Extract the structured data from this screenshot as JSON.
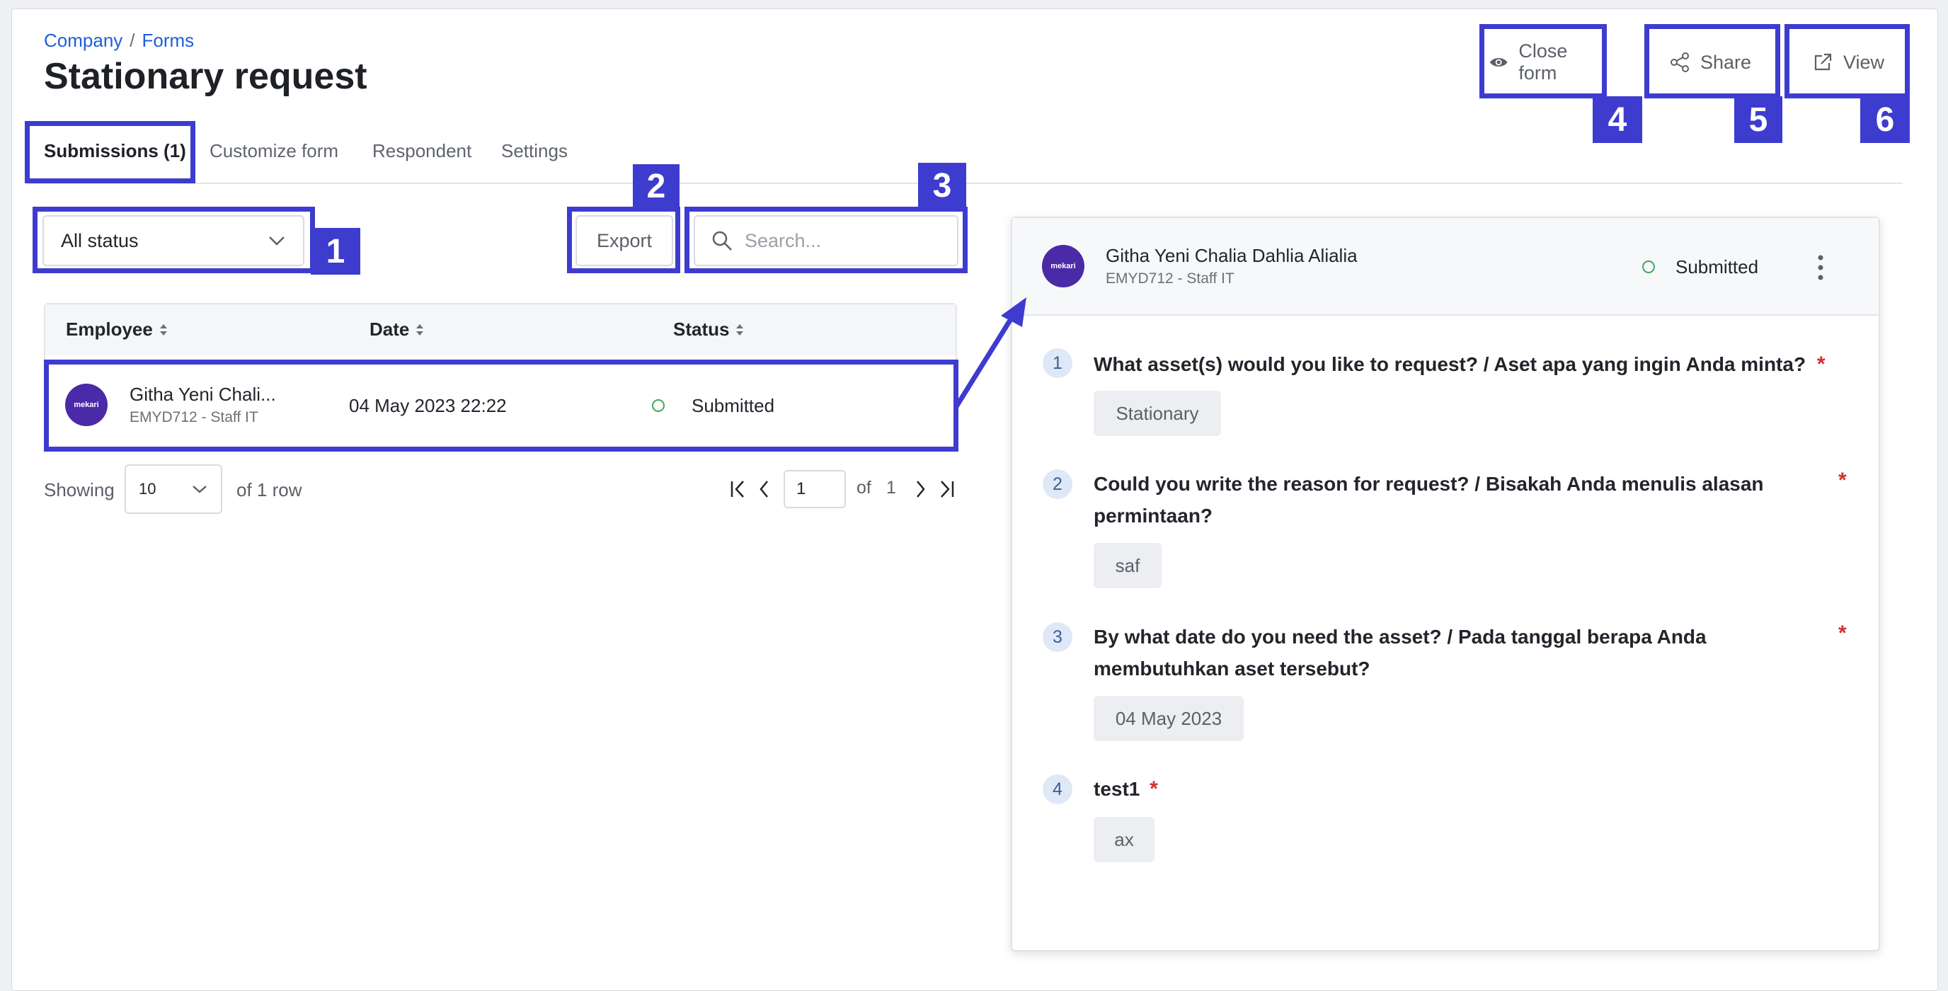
{
  "breadcrumb": {
    "company": "Company",
    "separator": "/",
    "forms": "Forms"
  },
  "page_title": "Stationary request",
  "header_actions": {
    "close_form": "Close form",
    "share": "Share",
    "view": "View"
  },
  "tabs": [
    {
      "label": "Submissions (1)",
      "active": true
    },
    {
      "label": "Customize form"
    },
    {
      "label": "Respondent"
    },
    {
      "label": "Settings"
    }
  ],
  "filters": {
    "status_select": "All status",
    "export_label": "Export",
    "search_placeholder": "Search..."
  },
  "table": {
    "columns": [
      "Employee",
      "Date",
      "Status"
    ],
    "rows": [
      {
        "name": "Githa Yeni Chali...",
        "subtitle": "EMYD712 - Staff IT",
        "date": "04 May 2023 22:22",
        "status": "Submitted",
        "avatar": "mekari"
      }
    ]
  },
  "pagination": {
    "showing_label": "Showing",
    "page_size": "10",
    "rows_label": "of 1 row",
    "current_page": "1",
    "of_label": "of",
    "total_pages": "1"
  },
  "detail": {
    "name": "Githa Yeni Chalia Dahlia Alialia",
    "subtitle": "EMYD712 - Staff IT",
    "status": "Submitted",
    "avatar": "mekari",
    "questions": [
      {
        "num": "1",
        "line1": "What asset(s) would you like to request? / Aset apa yang ingin Anda minta?",
        "line2": "",
        "required": "*",
        "answer": "Stationary"
      },
      {
        "num": "2",
        "line1": "Could you write the reason for request? / Bisakah Anda menulis alasan",
        "line2": "permintaan?",
        "required": "*",
        "answer": "saf"
      },
      {
        "num": "3",
        "line1": "By what date do you need the asset? / Pada tanggal berapa Anda",
        "line2": "membutuhkan aset tersebut?",
        "required": "*",
        "answer": "04 May 2023"
      },
      {
        "num": "4",
        "line1": "test1",
        "line2": "",
        "required": "*",
        "answer": "ax"
      }
    ]
  },
  "annotations": [
    "1",
    "2",
    "3",
    "4",
    "5",
    "6"
  ],
  "colors": {
    "accent": "#3d3ccf",
    "link": "#1f5ddc",
    "status": "#3ea85b",
    "required": "#d32f2f",
    "avatar": "#4b2aa8"
  }
}
